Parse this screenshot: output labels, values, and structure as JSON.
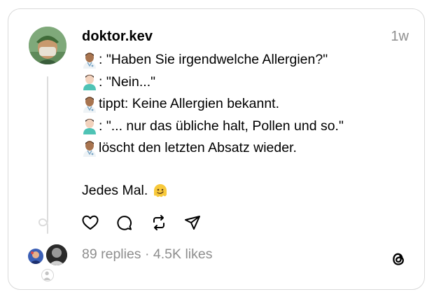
{
  "post": {
    "username": "doktor.kev",
    "time": "1w",
    "lines": [
      {
        "emoji": "doctor-man-emoji",
        "text": ": \"Haben Sie irgendwelche Allergien?\""
      },
      {
        "emoji": "patient-man-emoji",
        "text": ": \"Nein...\""
      },
      {
        "emoji": "doctor-man-emoji",
        "text": " tippt: Keine Allergien bekannt."
      },
      {
        "emoji": "patient-man-emoji",
        "text": ": \"... nur das übliche halt, Pollen und so.\""
      },
      {
        "emoji": "doctor-man-emoji",
        "text": " löscht den letzten Absatz wieder."
      }
    ],
    "closing": "Jedes Mal.",
    "closing_emoji": "melting-face-emoji"
  },
  "stats": {
    "replies": "89 replies",
    "separator": "·",
    "likes": "4.5K likes"
  },
  "actions": [
    "heart-icon",
    "comment-icon",
    "repost-icon",
    "share-icon"
  ],
  "colors": {
    "text": "#000000",
    "muted": "#8e8e8e",
    "border": "#d9d9d9",
    "thread_line": "#dcdcdc"
  }
}
